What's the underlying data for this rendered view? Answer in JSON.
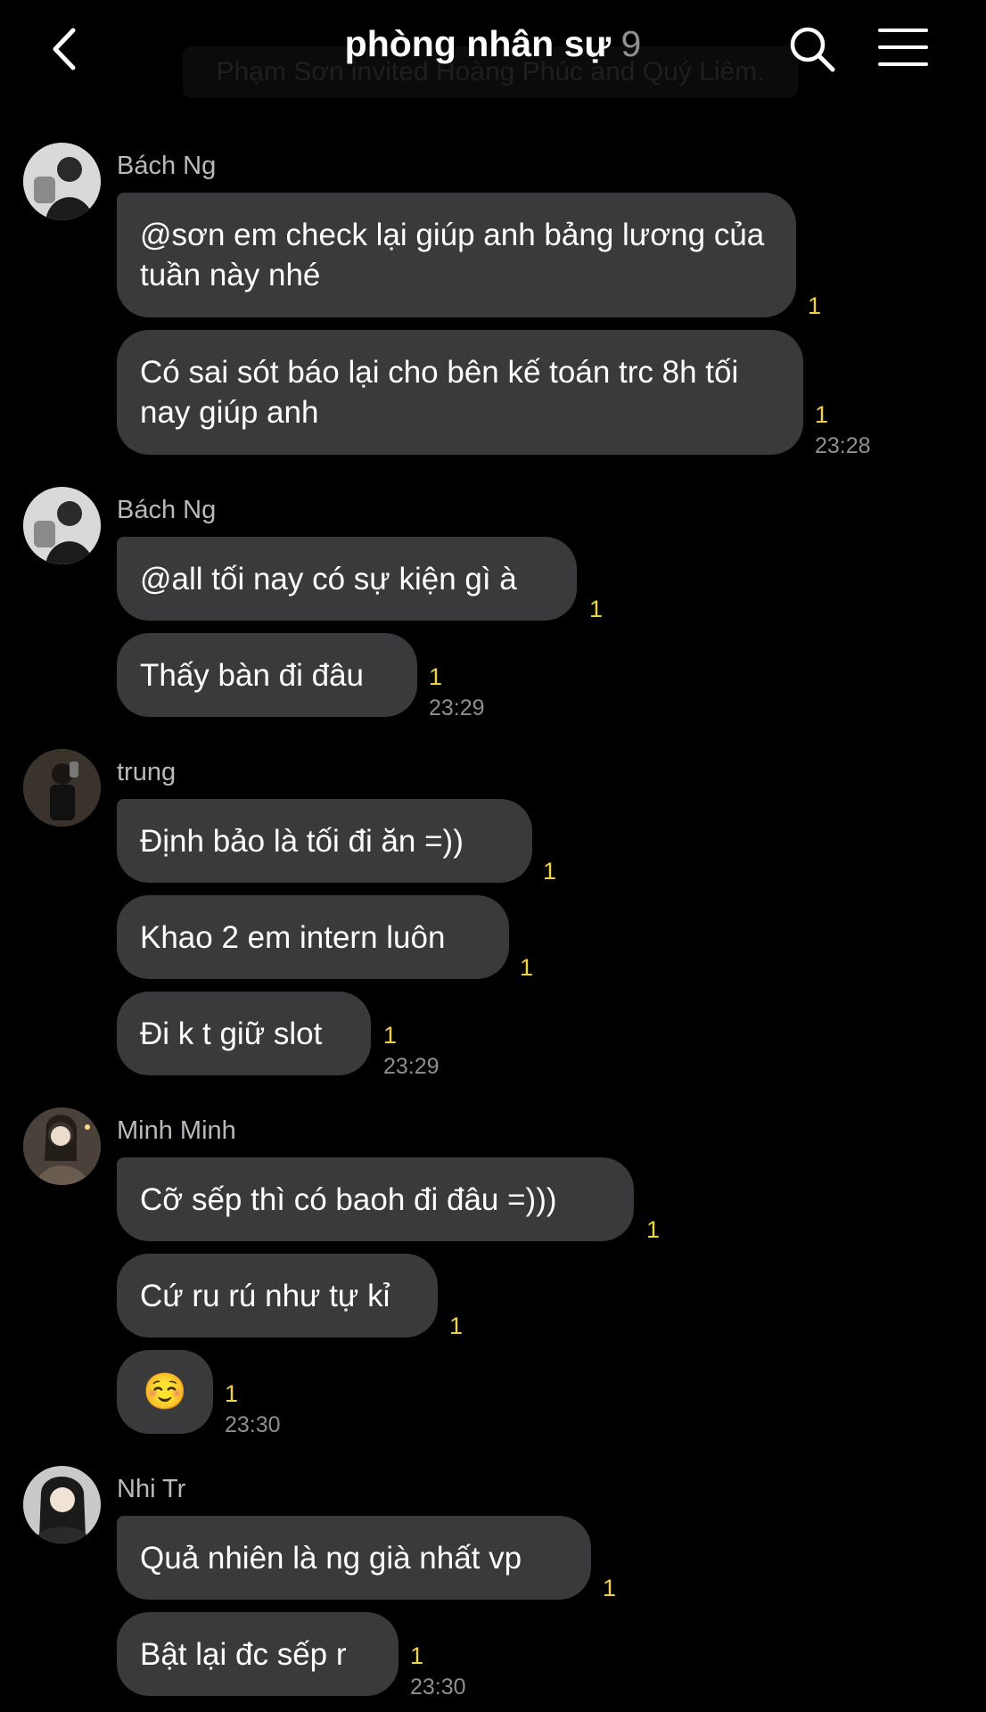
{
  "header": {
    "title": "phòng nhân sự",
    "member_count": "9",
    "system_notice": "Phạm Sơn invited Hoàng Phúc and Quý Liêm."
  },
  "groups": [
    {
      "sender": "Bách Ng",
      "messages": [
        {
          "text": "@sơn em check lại giúp anh bảng lương của tuần này nhé",
          "unread": "1"
        },
        {
          "text": "Có sai sót báo lại cho bên kế toán trc 8h tối nay giúp anh",
          "unread": "1",
          "time": "23:28"
        }
      ]
    },
    {
      "sender": "Bách Ng",
      "messages": [
        {
          "text": "@all tối nay có sự kiện gì à",
          "unread": "1"
        },
        {
          "text": "Thấy bàn đi đâu",
          "unread": "1",
          "time": "23:29"
        }
      ]
    },
    {
      "sender": "trung",
      "messages": [
        {
          "text": "Định bảo là tối đi ăn =))",
          "unread": "1"
        },
        {
          "text": "Khao 2 em intern luôn",
          "unread": "1"
        },
        {
          "text": "Đi k t giữ slot",
          "unread": "1",
          "time": "23:29"
        }
      ]
    },
    {
      "sender": "Minh Minh",
      "messages": [
        {
          "text": "Cỡ sếp thì có baoh đi đâu =)))",
          "unread": "1"
        },
        {
          "text": "Cứ ru rú như tự kỉ",
          "unread": "1"
        },
        {
          "text": "☺️",
          "unread": "1",
          "time": "23:30"
        }
      ]
    },
    {
      "sender": "Nhi Tr",
      "messages": [
        {
          "text": "Quả nhiên là ng già nhất vp",
          "unread": "1"
        },
        {
          "text": "Bật lại đc sếp r",
          "unread": "1",
          "time": "23:30"
        }
      ]
    }
  ],
  "colors": {
    "background": "#000000",
    "bubble": "#3a3a3c",
    "unread": "#f2d245",
    "meta": "#8e8e93"
  },
  "icons": {
    "back": "chevron-left-icon",
    "search": "search-icon",
    "menu": "hamburger-menu-icon"
  }
}
